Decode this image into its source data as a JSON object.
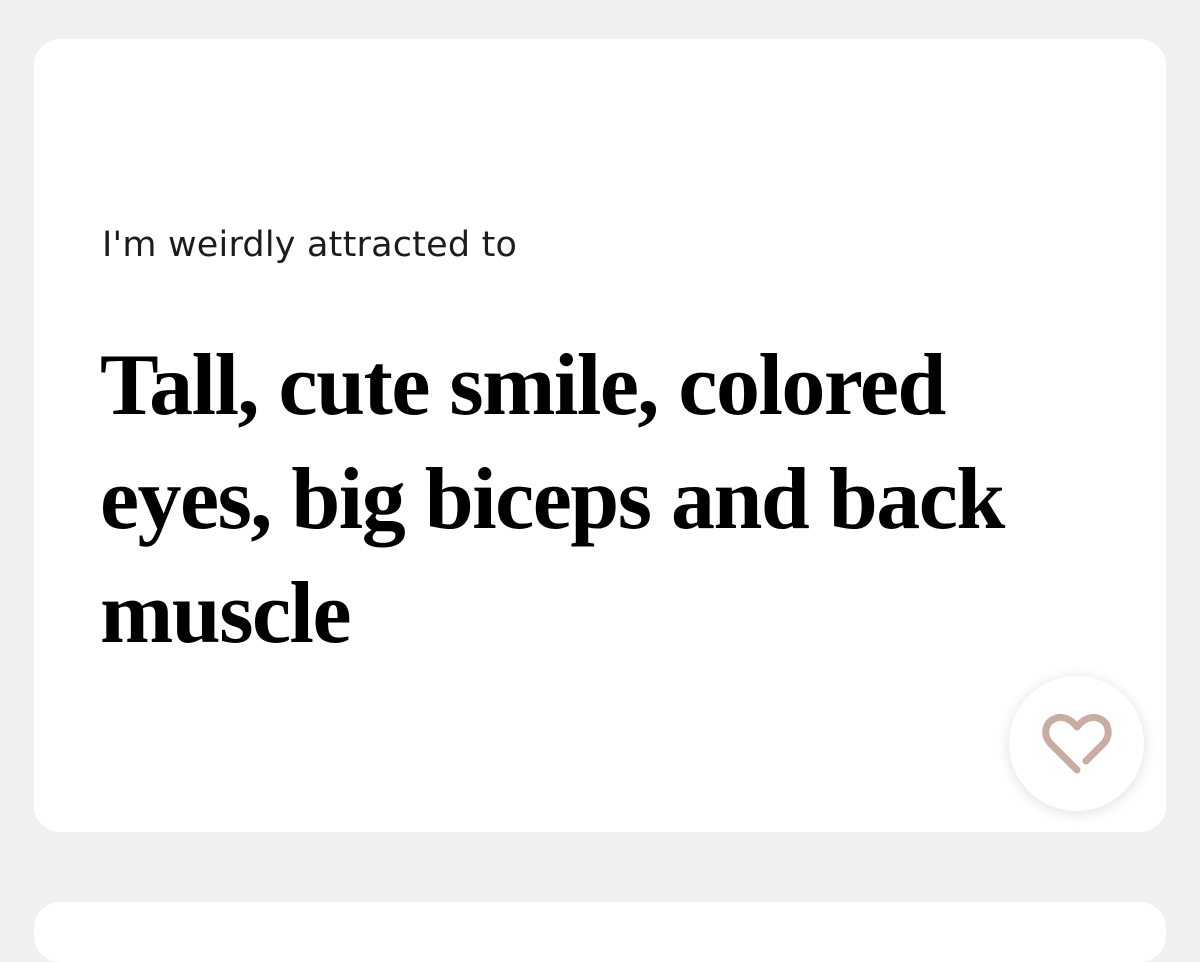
{
  "prompt": {
    "question": "I'm weirdly attracted to",
    "answer": "Tall, cute smile, colored eyes, big biceps and back muscle"
  },
  "like_button": {
    "icon": "heart-outline-icon",
    "color": "#c9ada3"
  },
  "colors": {
    "page_background": "#f0f0f0",
    "card_background": "#ffffff",
    "answer_text": "#000000",
    "question_text": "#1c1c1c"
  }
}
